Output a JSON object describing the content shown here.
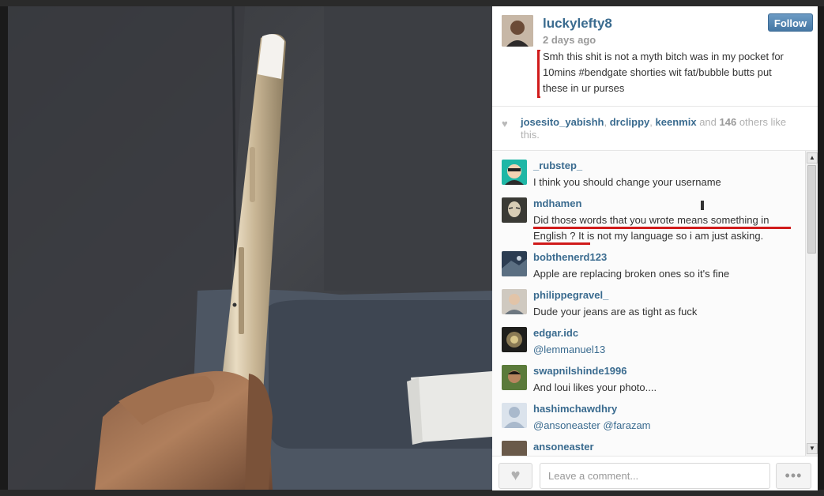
{
  "owner": {
    "username": "luckylefty8",
    "time": "2 days ago",
    "follow_label": "Follow",
    "caption": "Smh this shit is not a myth bitch was in my pocket for 10mins #bendgate shorties wit fat/bubble butts put these in ur purses"
  },
  "likes": {
    "users": [
      "josesito_yabishh",
      "drclippy",
      "keenmix"
    ],
    "sep1": ", ",
    "sep2": ", ",
    "and_text": " and ",
    "others_count": "146",
    "suffix": " others like this."
  },
  "comments": [
    {
      "user": "_rubstep_",
      "text": "I think you should change your username"
    },
    {
      "user": "mdhamen",
      "text": "Did those words that you wrote  means something in English ? It is not my language so i am just asking."
    },
    {
      "user": "bobthenerd123",
      "text": "Apple are replacing broken ones so it's fine"
    },
    {
      "user": "philippegravel_",
      "text": "Dude your jeans are as tight as fuck"
    },
    {
      "user": "edgar.idc",
      "text": "@lemmanuel13"
    },
    {
      "user": "swapnilshinde1996",
      "text": "And loui likes your photo...."
    },
    {
      "user": "hashimchawdhry",
      "text": "@ansoneaster @farazam"
    },
    {
      "user": "ansoneaster",
      "text": ""
    }
  ],
  "footer": {
    "comment_placeholder": "Leave a comment...",
    "heart_icon": "♥",
    "more_icon": "•••"
  },
  "scrollbar": {
    "up": "▲",
    "down": "▼"
  }
}
